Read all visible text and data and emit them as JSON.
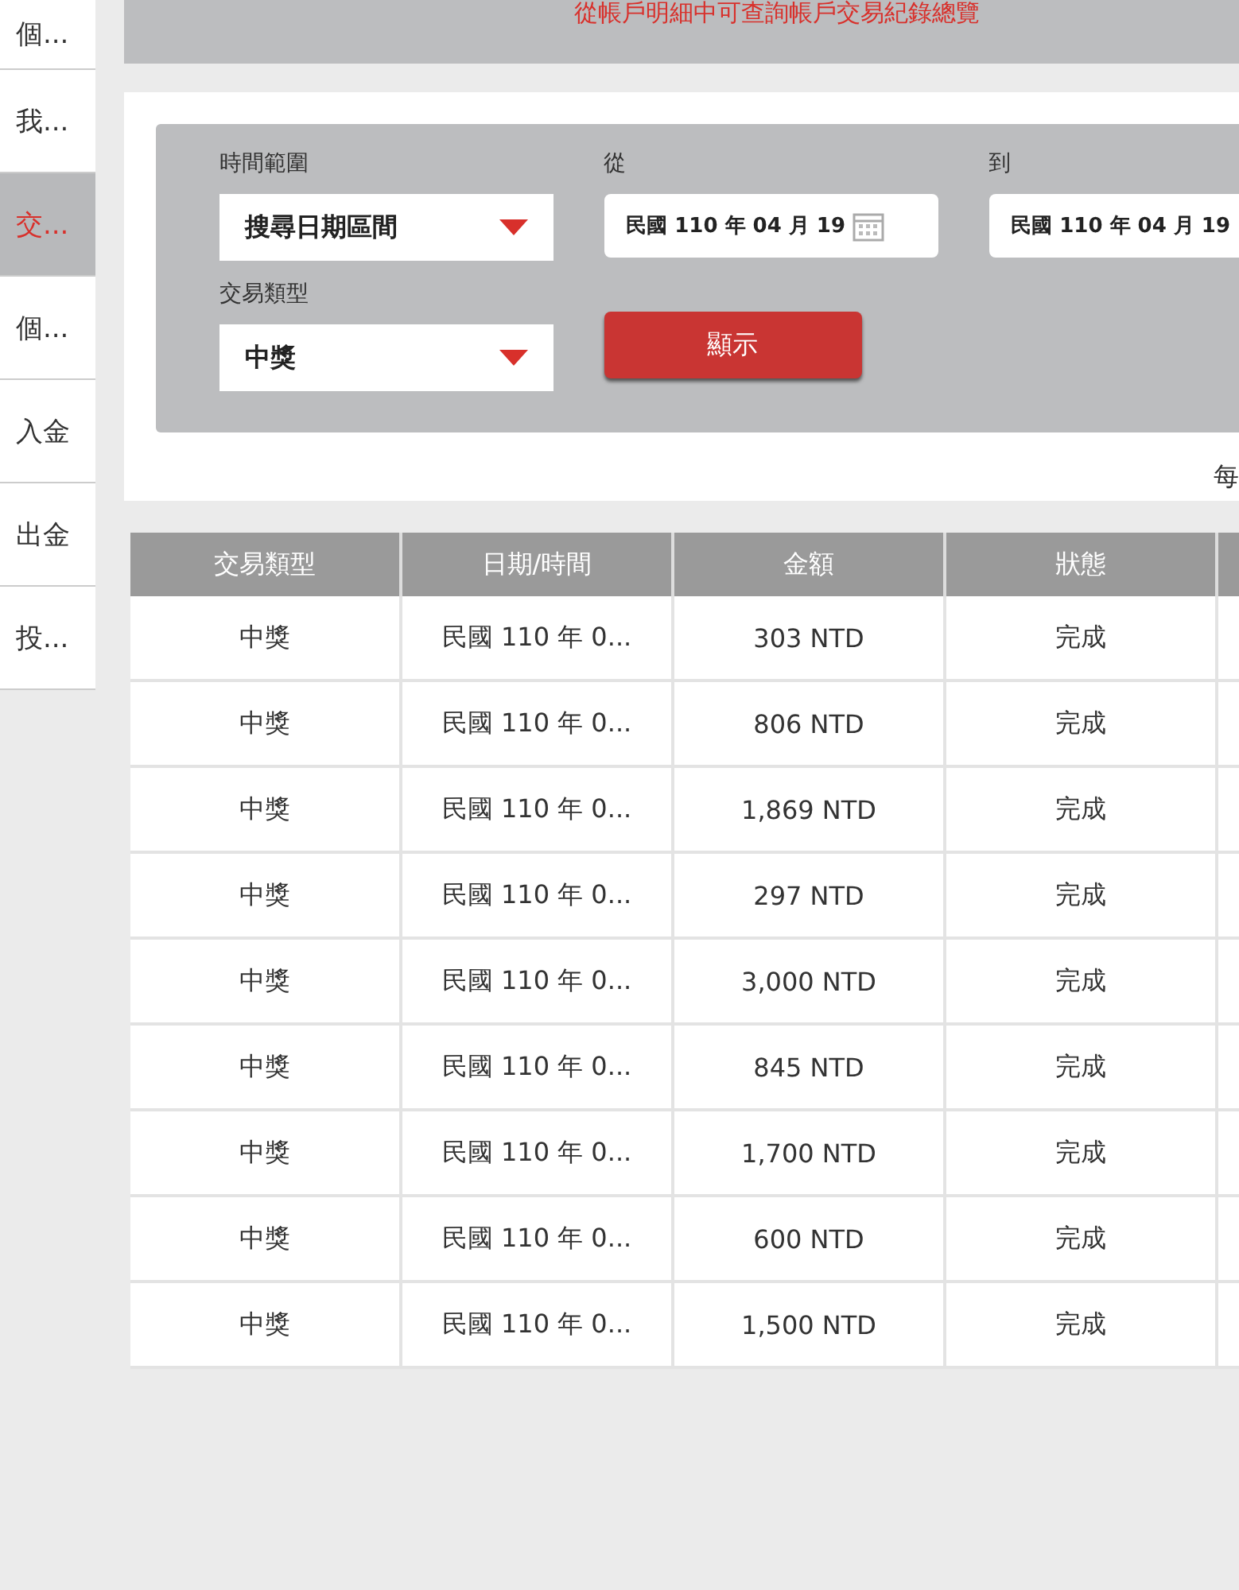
{
  "sidebar": {
    "items": [
      {
        "label": "個...",
        "selected": false
      },
      {
        "label": "我...",
        "selected": false
      },
      {
        "label": "交...",
        "selected": true
      },
      {
        "label": "個...",
        "selected": false
      },
      {
        "label": "入金",
        "selected": false
      },
      {
        "label": "出金",
        "selected": false
      },
      {
        "label": "投...",
        "selected": false
      }
    ]
  },
  "banner": {
    "text": "從帳戶明細中可查詢帳戶交易紀錄總覽"
  },
  "filter": {
    "time_range": {
      "label": "時間範圍",
      "value": "搜尋日期區間"
    },
    "from": {
      "label": "從",
      "value": "民國 110 年 04 月 19"
    },
    "to": {
      "label": "到",
      "value": "民國 110 年 04 月 19"
    },
    "type": {
      "label": "交易類型",
      "value": "中獎"
    },
    "show_button": "顯示"
  },
  "per_page_label": "每",
  "table": {
    "columns": [
      "交易類型",
      "日期/時間",
      "金額",
      "狀態"
    ],
    "rows": [
      [
        "中獎",
        "民國 110 年 0...",
        "303 NTD",
        "完成"
      ],
      [
        "中獎",
        "民國 110 年 0...",
        "806 NTD",
        "完成"
      ],
      [
        "中獎",
        "民國 110 年 0...",
        "1,869 NTD",
        "完成"
      ],
      [
        "中獎",
        "民國 110 年 0...",
        "297 NTD",
        "完成"
      ],
      [
        "中獎",
        "民國 110 年 0...",
        "3,000 NTD",
        "完成"
      ],
      [
        "中獎",
        "民國 110 年 0...",
        "845 NTD",
        "完成"
      ],
      [
        "中獎",
        "民國 110 年 0...",
        "1,700 NTD",
        "完成"
      ],
      [
        "中獎",
        "民國 110 年 0...",
        "600 NTD",
        "完成"
      ],
      [
        "中獎",
        "民國 110 年 0...",
        "1,500 NTD",
        "完成"
      ]
    ]
  }
}
